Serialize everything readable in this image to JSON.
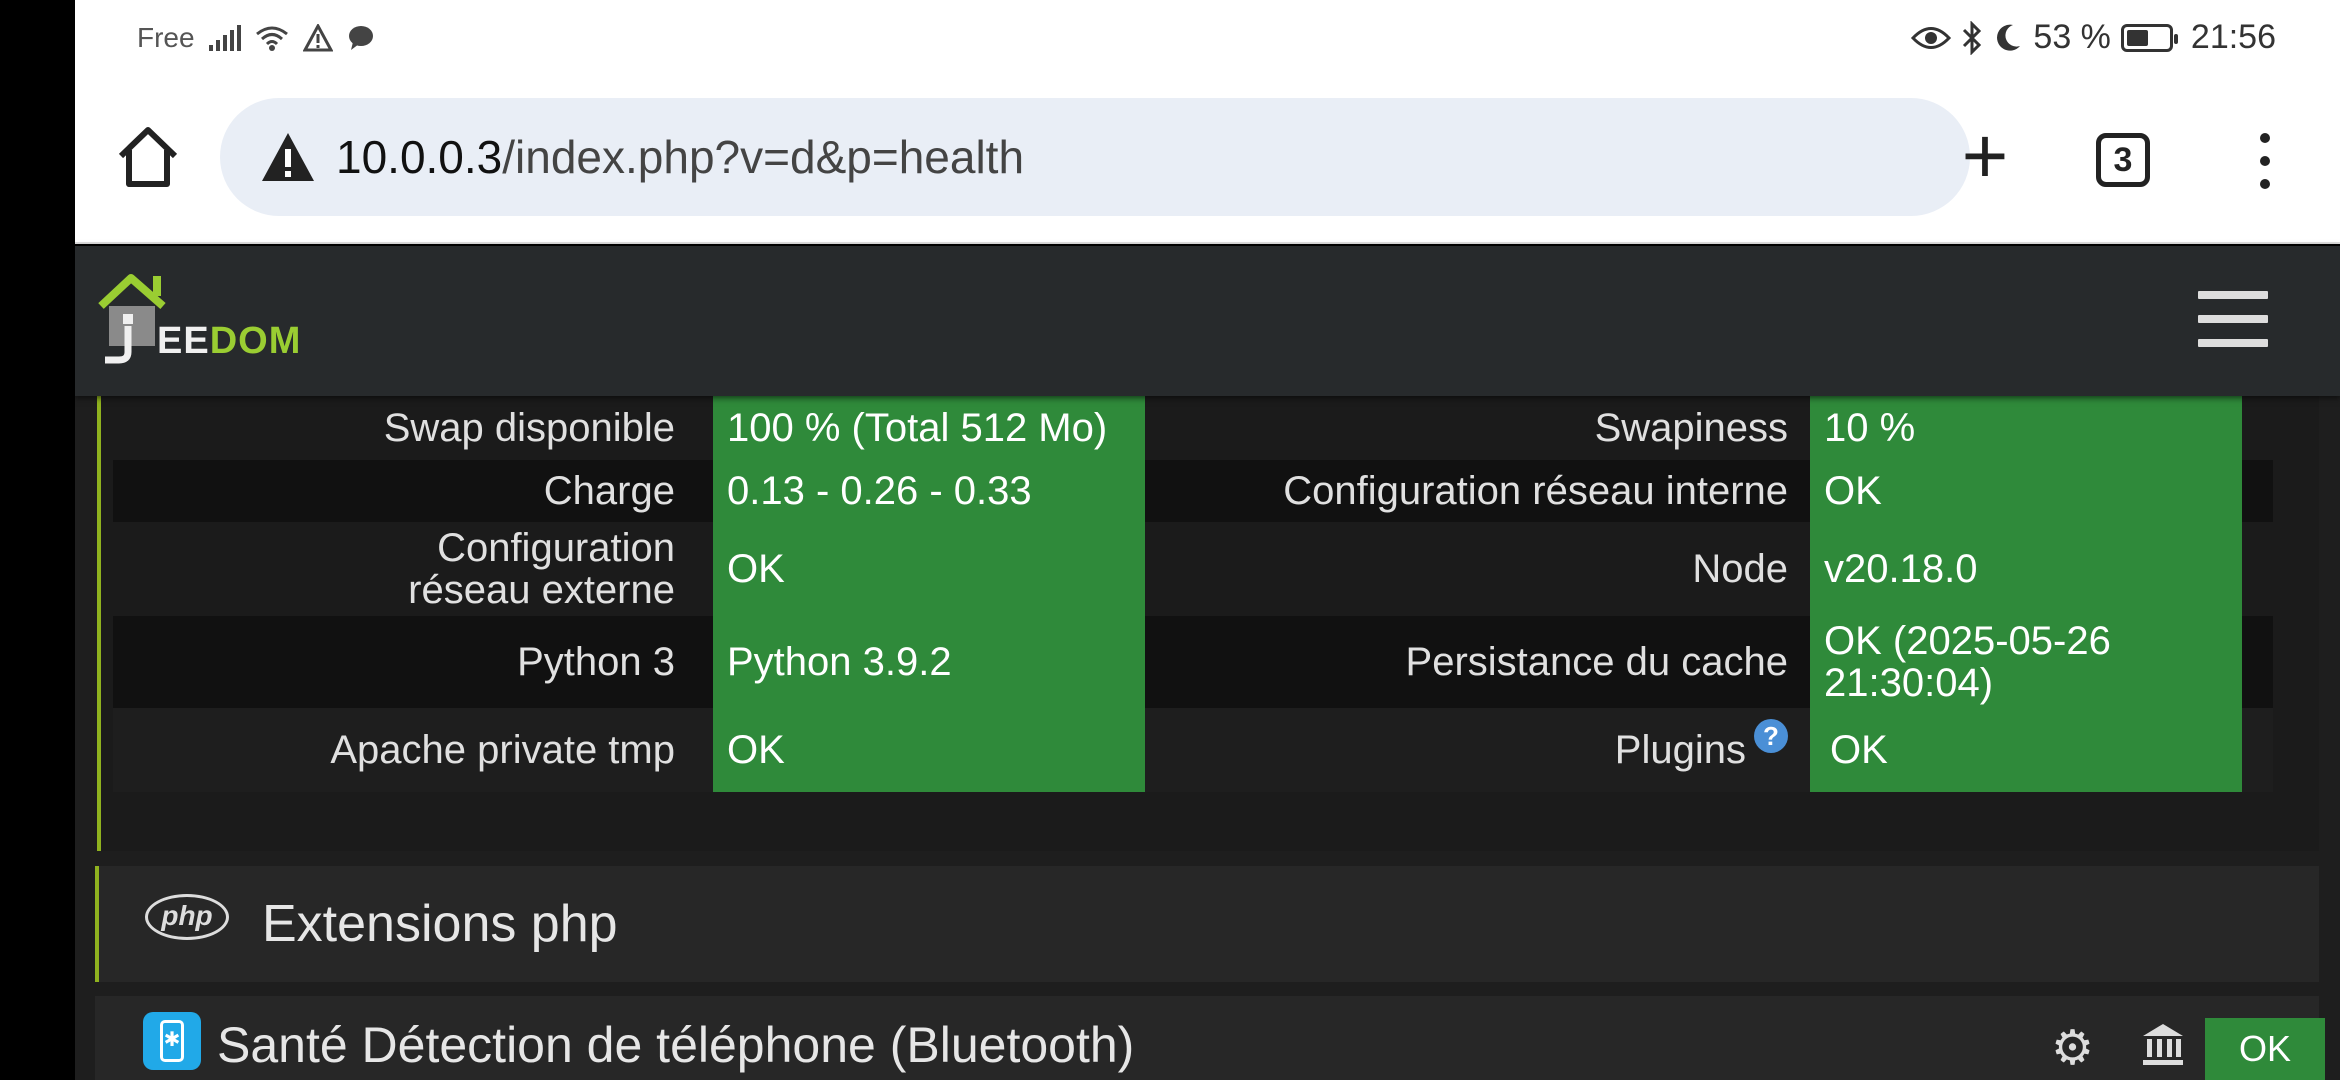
{
  "status_bar": {
    "carrier": "Free",
    "battery_percent": "53 %",
    "battery_level": 0.53,
    "time": "21:56"
  },
  "browser": {
    "url_host": "10.0.0.3",
    "url_path": "/index.php?v=d&p=health",
    "tab_count": "3"
  },
  "app": {
    "logo_text_a": "EE",
    "logo_text_b": "DOM",
    "brand_color": "#9acd32",
    "ok_color": "#2f8a3a"
  },
  "health": {
    "rows": [
      {
        "label1": "Swap disponible",
        "value1": "100 % (Total 512 Mo)",
        "label2": "Swapiness",
        "value2": "10 %"
      },
      {
        "label1": "Charge",
        "value1": "0.13 - 0.26 - 0.33",
        "label2": "Configuration réseau interne",
        "value2": "OK"
      },
      {
        "label1": "Configuration réseau externe",
        "value1": "OK",
        "label2": "Node",
        "value2": "v20.18.0"
      },
      {
        "label1": "Python 3",
        "value1": "Python 3.9.2",
        "label2": "Persistance du cache",
        "value2": "OK (2025-05-26 21:30:04)"
      },
      {
        "label1": "Apache private tmp",
        "value1": "OK",
        "label2": "Plugins",
        "value2": "OK",
        "help": "?"
      }
    ]
  },
  "php_panel": {
    "logo": "php",
    "title": "Extensions php"
  },
  "bt_panel": {
    "title": "Santé Détection de téléphone (Bluetooth)",
    "status": "OK"
  }
}
